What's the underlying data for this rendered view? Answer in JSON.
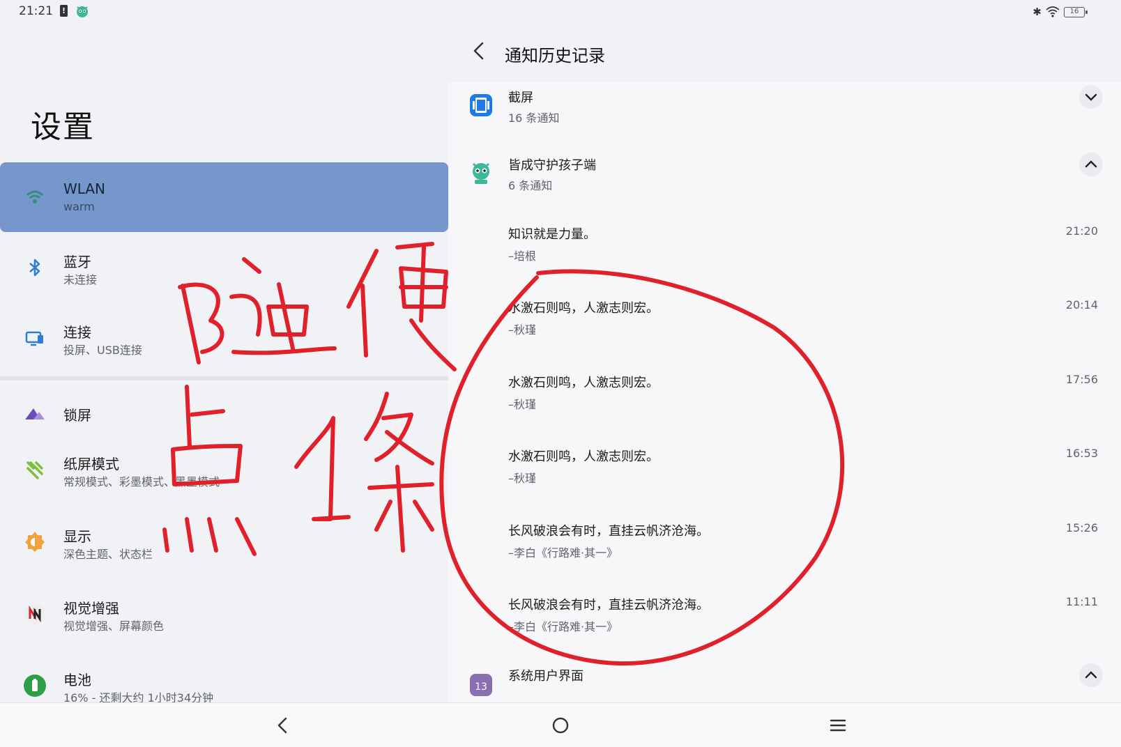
{
  "status_bar": {
    "time": "21:21",
    "warning_badge": "!",
    "battery_level": "16",
    "icons": [
      "battery-warning-icon",
      "child-guard-app-icon",
      "bluetooth-icon",
      "wifi-icon",
      "battery-icon"
    ]
  },
  "settings": {
    "title": "设置",
    "items": [
      {
        "label": "WLAN",
        "sub": "warm",
        "icon": "wifi-icon",
        "selected": true
      },
      {
        "label": "蓝牙",
        "sub": "未连接",
        "icon": "bluetooth-icon"
      },
      {
        "label": "连接",
        "sub": "投屏、USB连接",
        "icon": "connection-icon"
      },
      {
        "label": "锁屏",
        "sub": "",
        "icon": "lockscreen-icon"
      },
      {
        "label": "纸屏模式",
        "sub": "常规模式、彩墨模式、黑墨模式",
        "icon": "paper-mode-icon"
      },
      {
        "label": "显示",
        "sub": "深色主题、状态栏",
        "icon": "display-icon"
      },
      {
        "label": "视觉增强",
        "sub": "视觉增强、屏幕颜色",
        "icon": "visual-enhance-icon"
      },
      {
        "label": "电池",
        "sub": "16% - 还剩大约 1小时34分钟",
        "icon": "battery-icon"
      }
    ]
  },
  "history": {
    "title": "通知历史记录",
    "groups": [
      {
        "app": "截屏",
        "count": "16 条通知",
        "expanded": false,
        "icon": "screenshot-app-icon"
      },
      {
        "app": "皆成守护孩子端",
        "count": "6 条通知",
        "expanded": true,
        "icon": "child-guard-app-icon"
      },
      {
        "app": "系统用户界面",
        "count": "",
        "expanded": true,
        "icon": "system-ui-app-icon"
      }
    ],
    "notifications": [
      {
        "title": "知识就是力量。",
        "source": "–培根",
        "time": "21:20"
      },
      {
        "title": "水激石则鸣，人激志则宏。",
        "source": "–秋瑾",
        "time": "20:14"
      },
      {
        "title": "水激石则鸣，人激志则宏。",
        "source": "–秋瑾",
        "time": "17:56"
      },
      {
        "title": "水激石则鸣，人激志则宏。",
        "source": "–秋瑾",
        "time": "16:53"
      },
      {
        "title": "长风破浪会有时，直挂云帆济沧海。",
        "source": "–李白《行路难·其一》",
        "time": "15:26"
      },
      {
        "title": "长风破浪会有时，直挂云帆济沧海。",
        "source": "–李白《行路难·其一》",
        "time": "11:11"
      }
    ]
  },
  "annotation": {
    "text": "随便点1条",
    "color": "#e0202a"
  },
  "nav_bar": {
    "buttons": [
      "back-icon",
      "home-icon",
      "menu-icon"
    ]
  },
  "colors": {
    "selected_bg": "#7597cb",
    "panel_bg": "#f1f2f6",
    "list_bg": "#f7f7fa",
    "annotation_red": "#e0202a"
  }
}
